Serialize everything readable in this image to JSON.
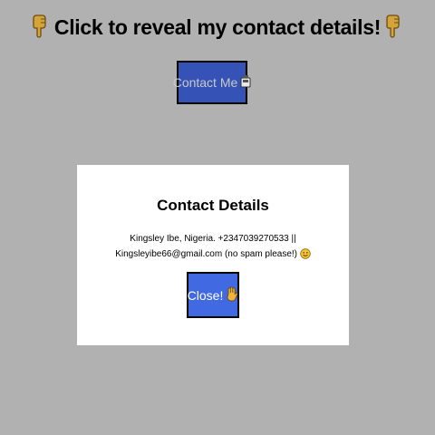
{
  "header": {
    "title": "Click to reveal my contact details!",
    "left_icon": "pointing-down-hand-icon",
    "right_icon": "pointing-down-hand-icon"
  },
  "contact_button": {
    "label": "Contact Me",
    "icon": "phone-icon",
    "bg_color": "#3553b6"
  },
  "modal": {
    "title": "Contact Details",
    "text": "Kingsley Ibe, Nigeria. +2347039270533 || Kingsleyibe66@gmail.com (no spam please!)",
    "emoji": "smiley-icon",
    "close_label": "Close!",
    "close_icon": "waving-hand-icon",
    "close_bg_color": "#4169e1"
  }
}
